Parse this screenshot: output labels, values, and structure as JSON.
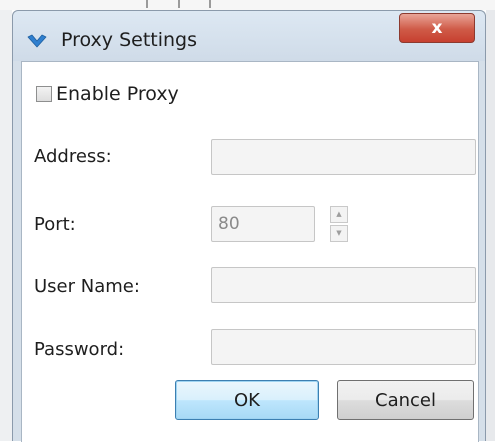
{
  "window": {
    "title": "Proxy Settings",
    "close_label": "x"
  },
  "form": {
    "enable_proxy_label": "Enable Proxy",
    "enable_proxy_checked": false,
    "address_label": "Address:",
    "address_value": "",
    "port_label": "Port:",
    "port_value": "80",
    "username_label": "User Name:",
    "username_value": "",
    "password_label": "Password:",
    "password_value": ""
  },
  "buttons": {
    "ok_label": "OK",
    "cancel_label": "Cancel"
  },
  "icons": {
    "app_icon": "v-chevron-icon",
    "close_icon": "close-icon",
    "spin_up_icon": "triangle-up-icon",
    "spin_down_icon": "triangle-down-icon"
  },
  "colors": {
    "title_bar": "#d5dfe9",
    "close_button": "#c74030",
    "app_icon": "#2f7fcf",
    "ok_button_border": "#3c7fb1",
    "disabled_field": "#f4f4f4"
  }
}
